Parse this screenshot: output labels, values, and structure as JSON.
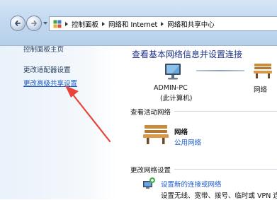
{
  "breadcrumb": {
    "items": [
      "控制面板",
      "网络和 Internet",
      "网络和共享中心"
    ]
  },
  "sidebar": {
    "title": "控制面板主页",
    "links": [
      "更改适配器设置",
      "更改高级共享设置"
    ]
  },
  "main": {
    "title": "查看基本网络信息并设置连接",
    "computer_name": "ADMIN-PC",
    "computer_sub": "(此计算机)",
    "network_top_label": "网络",
    "active_section": "查看活动网络",
    "active_network_name": "网络",
    "active_network_type": "公用网络",
    "change_section": "更改网络设置",
    "setup_link": "设置新的连接或网络",
    "setup_desc": "设置无线、宽带、拨号、临时或 VPN 连"
  },
  "colors": {
    "link": "#1a5ac8",
    "title": "#1e3287",
    "annotation_arrow": "#e8443a"
  },
  "icons": [
    "back-arrow-icon",
    "forward-arrow-icon",
    "control-panel-icon",
    "computer-icon",
    "bench-icon",
    "network-setup-icon"
  ]
}
